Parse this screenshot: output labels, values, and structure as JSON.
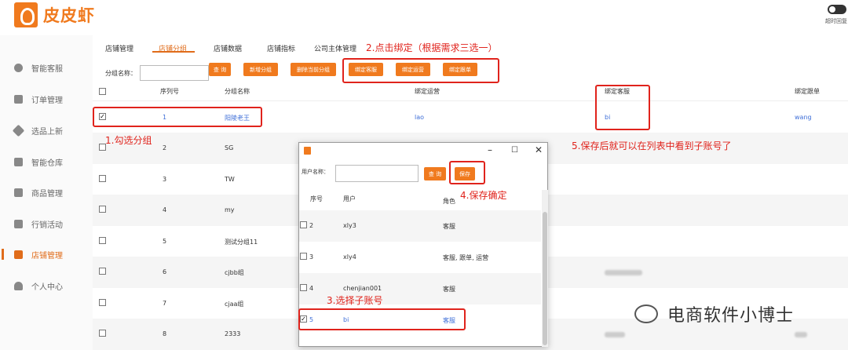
{
  "brand": {
    "name": "皮皮虾"
  },
  "toggle": {
    "label": "超时回复"
  },
  "sidebar": {
    "items": [
      {
        "label": "智能客服",
        "icon": "headset-icon"
      },
      {
        "label": "订单管理",
        "icon": "order-icon"
      },
      {
        "label": "选品上新",
        "icon": "tag-icon"
      },
      {
        "label": "智能仓库",
        "icon": "warehouse-icon"
      },
      {
        "label": "商品管理",
        "icon": "bag-icon"
      },
      {
        "label": "行销活动",
        "icon": "promo-icon"
      },
      {
        "label": "店铺管理",
        "icon": "shop-icon",
        "active": true
      },
      {
        "label": "个人中心",
        "icon": "user-icon"
      }
    ]
  },
  "tabs": [
    "店铺管理",
    "店铺分组",
    "店铺数据",
    "店铺指标",
    "公司主体管理"
  ],
  "filter": {
    "label": "分组名称：",
    "query": "查 询",
    "add": "新增分组",
    "delete": "删除当前分组",
    "bind_cs": "绑定客服",
    "bind_ops": "绑定运营",
    "bind_order": "绑定跟单"
  },
  "table": {
    "headers": [
      "序列号",
      "分组名称",
      "绑定运营",
      "绑定客服",
      "绑定跟单"
    ],
    "rows": [
      {
        "no": "1",
        "name": "阳陵老王",
        "ops": "lao",
        "cs": "bi",
        "order": "wang",
        "checked": true
      },
      {
        "no": "2",
        "name": "SG"
      },
      {
        "no": "3",
        "name": "TW"
      },
      {
        "no": "4",
        "name": "my"
      },
      {
        "no": "5",
        "name": "测试分组11"
      },
      {
        "no": "6",
        "name": "cjbb组"
      },
      {
        "no": "7",
        "name": "cjaa组"
      },
      {
        "no": "8",
        "name": "2333"
      }
    ]
  },
  "dialog": {
    "search_label": "用户名称：",
    "query": "查 询",
    "save": "保存",
    "headers": [
      "序号",
      "用户",
      "角色"
    ],
    "rows": [
      {
        "no": "2",
        "user": "xly3",
        "role": "客服"
      },
      {
        "no": "3",
        "user": "xly4",
        "role": "客服, 跟单, 运营"
      },
      {
        "no": "4",
        "user": "chenjian001",
        "role": "客服"
      },
      {
        "no": "5",
        "user": "bi",
        "role": "客服",
        "checked": true
      }
    ]
  },
  "annotations": {
    "a1": "1.勾选分组",
    "a2": "2.点击绑定（根据需求三选一）",
    "a3": "3.选择子账号",
    "a4": "4.保存确定",
    "a5": "5.保存后就可以在列表中看到子账号了"
  },
  "watermark": "电商软件小博士",
  "colors": {
    "accent": "#f07a1e",
    "annotation": "#e0231c",
    "link": "#3f6fd8"
  }
}
